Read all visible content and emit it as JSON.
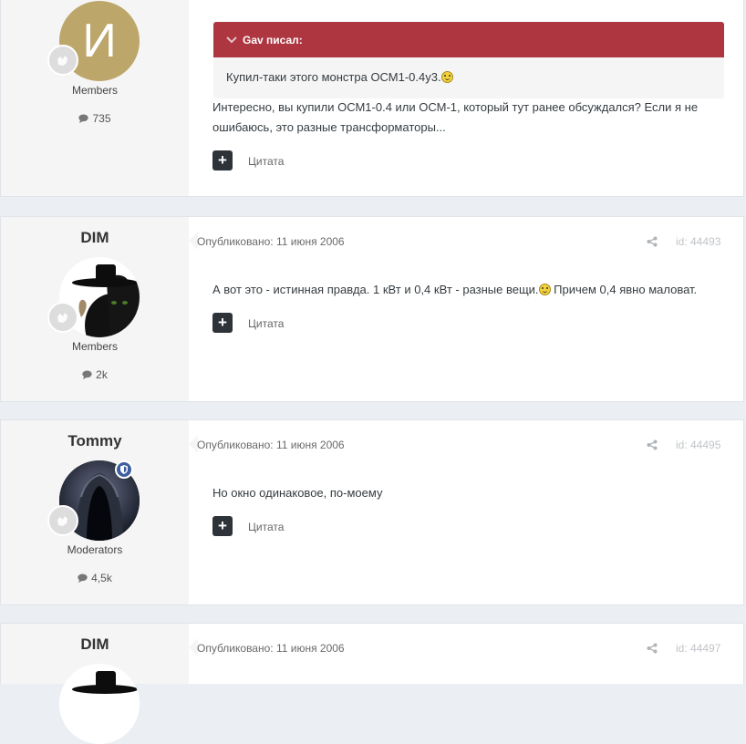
{
  "posts": [
    {
      "author_name": "",
      "avatar_letter": "И",
      "group": "Members",
      "post_count": "735",
      "quote": {
        "header": "Gav писал:",
        "text": "Купил-таки этого монстра ОСМ1-0.4у3."
      },
      "text_line1": "Интересно, вы купили ОСМ1-0.4 или ОСМ-1, который тут ранее обсуждался? Если я не",
      "text_line2": "ошибаюсь, это разные трансформаторы...",
      "quote_label": "Цитата"
    },
    {
      "author_name": "DIM",
      "group": "Members",
      "post_count": "2k",
      "published": "Опубликовано: 11 июня 2006",
      "post_id": "id: 44493",
      "text_a": "А вот это - истинная правда. 1 кВт и 0,4 кВт - разные вещи.",
      "text_b": " Причем 0,4 явно маловат.",
      "quote_label": "Цитата"
    },
    {
      "author_name": "Tommy",
      "group": "Moderators",
      "post_count": "4,5k",
      "published": "Опубликовано: 11 июня 2006",
      "post_id": "id: 44495",
      "text": "Но окно одинаковое, по-моему",
      "quote_label": "Цитата"
    },
    {
      "author_name": "DIM",
      "published": "Опубликовано: 11 июня 2006",
      "post_id": "id: 44497"
    }
  ],
  "colors": {
    "quote_header": "#ae3641",
    "author_panel": "#f5f5f5",
    "avatar_gold": "#bda66a",
    "moderator_badge": "#3d5f9e"
  }
}
